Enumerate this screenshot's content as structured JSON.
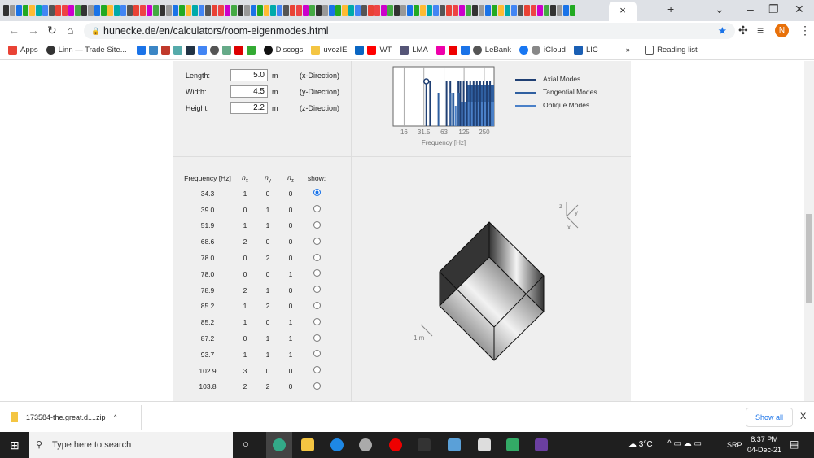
{
  "browser": {
    "active_tab_close": "×",
    "new_tab": "+",
    "url": "hunecke.de/en/calculators/room-eigenmodes.html",
    "profile_initial": "N",
    "bookmarks": [
      "Apps",
      "Linn — Trade Site...",
      "Discogs",
      "uvozIE",
      "WT",
      "LMA",
      "LeBank",
      "iCloud",
      "LIC"
    ],
    "more": "»",
    "reading_list": "Reading list"
  },
  "dimensions": [
    {
      "label": "Length:",
      "value": "5.0",
      "unit": "m",
      "direction": "(x-Direction)"
    },
    {
      "label": "Width:",
      "value": "4.5",
      "unit": "m",
      "direction": "(y-Direction)"
    },
    {
      "label": "Height:",
      "value": "2.2",
      "unit": "m",
      "direction": "(z-Direction)"
    }
  ],
  "chart_data": {
    "type": "bar",
    "xlabel": "Frequency [Hz]",
    "xscale": "log",
    "xlim": [
      11,
      350
    ],
    "xticks": [
      "16",
      "31.5",
      "63",
      "125",
      "250"
    ],
    "legend": [
      {
        "name": "Axial Modes",
        "color": "#1f3f73"
      },
      {
        "name": "Tangential Modes",
        "color": "#2f5fa0"
      },
      {
        "name": "Oblique Modes",
        "color": "#4a80c8"
      }
    ],
    "modes": [
      {
        "f": 34.3,
        "type": "axial",
        "selected": true
      },
      {
        "f": 39.0,
        "type": "axial"
      },
      {
        "f": 51.9,
        "type": "tangential"
      },
      {
        "f": 68.6,
        "type": "axial"
      },
      {
        "f": 78.0,
        "type": "axial"
      },
      {
        "f": 78.9,
        "type": "tangential"
      },
      {
        "f": 85.2,
        "type": "tangential"
      },
      {
        "f": 87.2,
        "type": "tangential"
      },
      {
        "f": 93.7,
        "type": "oblique"
      },
      {
        "f": 102.9,
        "type": "axial"
      },
      {
        "f": 103.8,
        "type": "tangential"
      }
    ],
    "legend_placement": "right",
    "grid": true
  },
  "table": {
    "headers": [
      "Frequency [Hz]",
      "n",
      "n",
      "n",
      "show:"
    ],
    "subs": [
      "",
      "x",
      "y",
      "z",
      ""
    ],
    "rows": [
      [
        "34.3",
        "1",
        "0",
        "0",
        true
      ],
      [
        "39.0",
        "0",
        "1",
        "0",
        false
      ],
      [
        "51.9",
        "1",
        "1",
        "0",
        false
      ],
      [
        "68.6",
        "2",
        "0",
        "0",
        false
      ],
      [
        "78.0",
        "0",
        "2",
        "0",
        false
      ],
      [
        "78.0",
        "0",
        "0",
        "1",
        false
      ],
      [
        "78.9",
        "2",
        "1",
        "0",
        false
      ],
      [
        "85.2",
        "1",
        "2",
        "0",
        false
      ],
      [
        "85.2",
        "1",
        "0",
        "1",
        false
      ],
      [
        "87.2",
        "0",
        "1",
        "1",
        false
      ],
      [
        "93.7",
        "1",
        "1",
        "1",
        false
      ],
      [
        "102.9",
        "3",
        "0",
        "0",
        false
      ],
      [
        "103.8",
        "2",
        "2",
        "0",
        false
      ]
    ]
  },
  "view3d": {
    "axes": [
      "z",
      "y",
      "x"
    ],
    "scale": "1 m"
  },
  "download": {
    "file": "173584-the.great.d....zip",
    "show_all": "Show all",
    "close": "X"
  },
  "taskbar": {
    "search": "Type here to search",
    "temp": "3°C",
    "lang": "SRP",
    "time": "8:37 PM",
    "date": "04-Dec-21"
  }
}
